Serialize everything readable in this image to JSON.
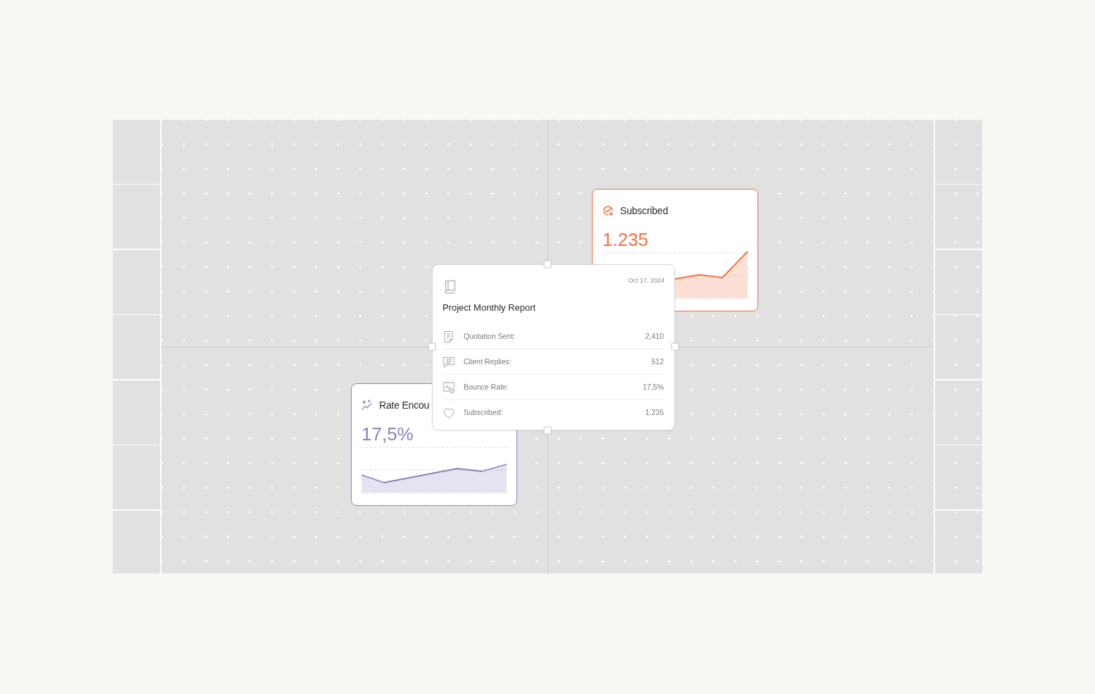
{
  "metric_cards": [
    {
      "title": "Subscribed",
      "value": "1.235",
      "color": "#f4703f"
    },
    {
      "title": "Rate Encou",
      "value": "17,5%",
      "color": "#8b80bd"
    }
  ],
  "report_card": {
    "date": "Oct 17, 2024",
    "title": "Project Monthly Report",
    "rows": [
      {
        "label": "Quotation Sent:",
        "value": "2,410"
      },
      {
        "label": "Client Replies:",
        "value": "512"
      },
      {
        "label": "Bounce Rate:",
        "value": "17,5%"
      },
      {
        "label": "Subscribed:",
        "value": "1.235"
      }
    ]
  }
}
